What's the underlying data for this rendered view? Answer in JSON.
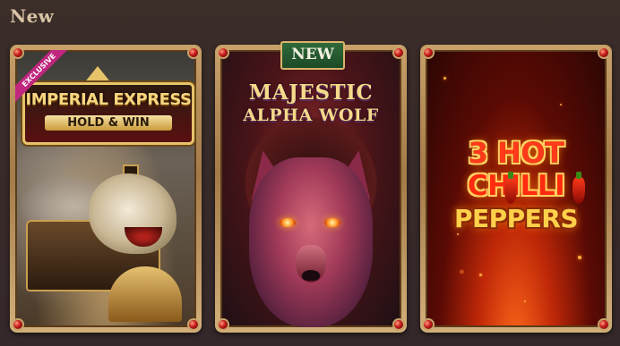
{
  "section": {
    "title": "New"
  },
  "games": [
    {
      "id": "imperial-express",
      "badge": "EXCLUSIVE",
      "logo_line1": "IMPERIAL EXPRESS",
      "logo_line2": "HOLD & WIN"
    },
    {
      "id": "majestic-alpha-wolf",
      "tag": "NEW",
      "logo_line1": "MAJESTIC",
      "logo_line2": "ALPHA WOLF"
    },
    {
      "id": "3-hot-chilli-peppers",
      "logo_line1": "3 HOT",
      "logo_line2": "CHILLI",
      "logo_line3": "PEPPERS"
    }
  ],
  "colors": {
    "background": "#38292a",
    "frame_gold": "#c8a06a",
    "corner_gem": "#c41a1a",
    "new_tag": "#2f6a3a",
    "exclusive_badge": "#c0267e"
  }
}
